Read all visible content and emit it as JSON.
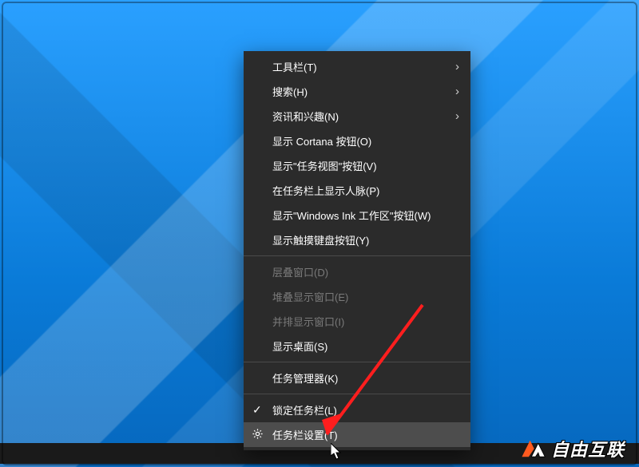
{
  "menu": {
    "sections": [
      [
        {
          "key": "toolbars",
          "label": "工具栏(T)",
          "submenu": true,
          "enabled": true
        },
        {
          "key": "search",
          "label": "搜索(H)",
          "submenu": true,
          "enabled": true
        },
        {
          "key": "news",
          "label": "资讯和兴趣(N)",
          "submenu": true,
          "enabled": true
        },
        {
          "key": "cortana",
          "label": "显示 Cortana 按钮(O)",
          "submenu": false,
          "enabled": true
        },
        {
          "key": "taskview",
          "label": "显示\"任务视图\"按钮(V)",
          "submenu": false,
          "enabled": true
        },
        {
          "key": "people",
          "label": "在任务栏上显示人脉(P)",
          "submenu": false,
          "enabled": true
        },
        {
          "key": "ink",
          "label": "显示\"Windows Ink 工作区\"按钮(W)",
          "submenu": false,
          "enabled": true
        },
        {
          "key": "touchkb",
          "label": "显示触摸键盘按钮(Y)",
          "submenu": false,
          "enabled": true
        }
      ],
      [
        {
          "key": "cascade",
          "label": "层叠窗口(D)",
          "submenu": false,
          "enabled": false
        },
        {
          "key": "stacked",
          "label": "堆叠显示窗口(E)",
          "submenu": false,
          "enabled": false
        },
        {
          "key": "sidebyside",
          "label": "并排显示窗口(I)",
          "submenu": false,
          "enabled": false
        },
        {
          "key": "showdesktop",
          "label": "显示桌面(S)",
          "submenu": false,
          "enabled": true
        }
      ],
      [
        {
          "key": "taskmgr",
          "label": "任务管理器(K)",
          "submenu": false,
          "enabled": true
        }
      ],
      [
        {
          "key": "lock",
          "label": "锁定任务栏(L)",
          "submenu": false,
          "enabled": true,
          "checked": true
        },
        {
          "key": "settings",
          "label": "任务栏设置(T)",
          "submenu": false,
          "enabled": true,
          "icon": "gear",
          "hover": true
        }
      ]
    ]
  },
  "watermark": {
    "text": "自由互联"
  }
}
